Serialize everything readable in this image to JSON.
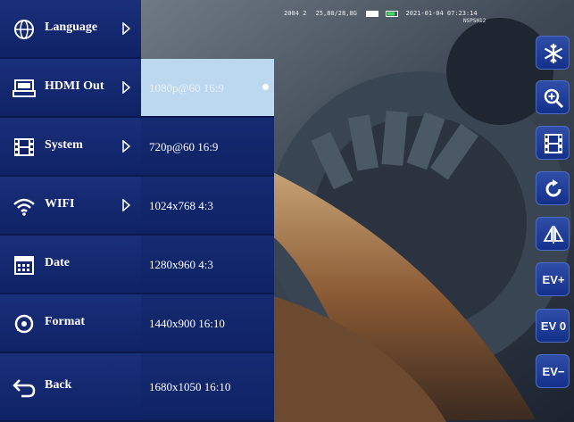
{
  "menu": {
    "items": [
      {
        "label": "Language",
        "icon": "globe-icon",
        "has_submenu": true
      },
      {
        "label": "HDMI Out",
        "icon": "hdmi-icon",
        "has_submenu": true
      },
      {
        "label": "System",
        "icon": "film-icon",
        "has_submenu": true
      },
      {
        "label": "WIFI",
        "icon": "wifi-icon",
        "has_submenu": true
      },
      {
        "label": "Date",
        "icon": "calendar-icon",
        "has_submenu": false
      },
      {
        "label": "Format",
        "icon": "format-icon",
        "has_submenu": false
      },
      {
        "label": "Back",
        "icon": "back-arrow-icon",
        "has_submenu": false
      }
    ]
  },
  "submenu": {
    "selected_index": 0,
    "options": [
      {
        "label": "1080p@60 16:9"
      },
      {
        "label": "720p@60 16:9"
      },
      {
        "label": "1024x768 4:3"
      },
      {
        "label": "1280x960 4:3"
      },
      {
        "label": "1440x900 16:10"
      },
      {
        "label": "1680x1050 16:10"
      }
    ]
  },
  "status": {
    "left_text": "2004 2",
    "storage": "25,80/28,8G",
    "datetime": "2021-01-04 07:23:14",
    "model": "NSPSH12"
  },
  "toolbar": {
    "buttons": [
      {
        "name": "freeze",
        "icon": "snowflake-icon"
      },
      {
        "name": "zoom",
        "icon": "zoom-in-icon"
      },
      {
        "name": "gallery",
        "icon": "film-icon"
      },
      {
        "name": "rotate",
        "icon": "rotate-icon"
      },
      {
        "name": "mirror",
        "icon": "mirror-flip-icon"
      },
      {
        "name": "ev-plus",
        "label": "EV+"
      },
      {
        "name": "ev-zero",
        "label": "EV 0"
      },
      {
        "name": "ev-minus",
        "label": "EV−"
      }
    ]
  },
  "colors": {
    "menu_bg": "#0f2266",
    "selected_bg": "#bcd8ee",
    "button_bg": "#1f3d98"
  }
}
